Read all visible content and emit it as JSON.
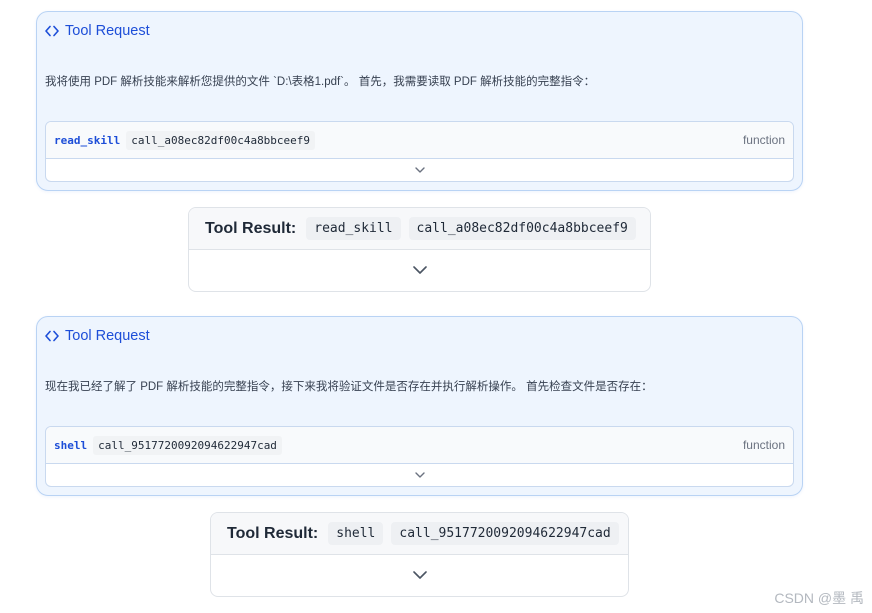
{
  "blocks": [
    {
      "request": {
        "title": "Tool Request",
        "text": "我将使用 PDF 解析技能来解析您提供的文件 `D:\\表格1.pdf`。 首先，我需要读取 PDF 解析技能的完整指令：",
        "function_name": "read_skill",
        "call_id": "call_a08ec82df00c4a8bbceef9",
        "type_label": "function"
      },
      "result": {
        "label": "Tool Result:",
        "function_name": "read_skill",
        "call_id": "call_a08ec82df00c4a8bbceef9"
      }
    },
    {
      "request": {
        "title": "Tool Request",
        "text": "现在我已经了解了 PDF 解析技能的完整指令，接下来我将验证文件是否存在并执行解析操作。 首先检查文件是否存在：",
        "function_name": "shell",
        "call_id": "call_9517720092094622947cad",
        "type_label": "function"
      },
      "result": {
        "label": "Tool Result:",
        "function_name": "shell",
        "call_id": "call_9517720092094622947cad"
      }
    }
  ],
  "watermark": "CSDN @墨 禹",
  "icons": {
    "header": "code-brackets-icon",
    "toggle": "chevron-down-icon"
  },
  "colors": {
    "accent": "#1d4ed8",
    "request_bg": "#eef5fe",
    "request_border": "#b9d3f4"
  }
}
